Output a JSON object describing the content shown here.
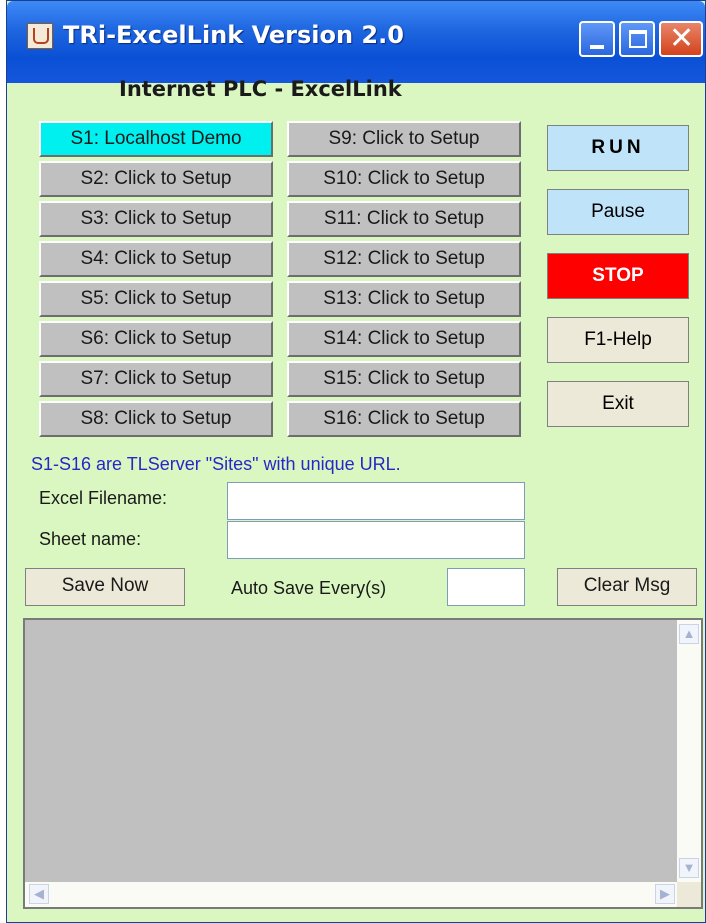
{
  "window": {
    "title": "TRi-ExcelLink Version 2.0",
    "heading": "Internet PLC - ExcelLink"
  },
  "sites": {
    "left": [
      "S1: Localhost Demo",
      "S2: Click to Setup",
      "S3: Click to Setup",
      "S4: Click to Setup",
      "S5: Click to Setup",
      "S6: Click to Setup",
      "S7: Click to Setup",
      "S8: Click to Setup"
    ],
    "right": [
      "S9: Click to Setup",
      "S10: Click to Setup",
      "S11: Click to Setup",
      "S12: Click to Setup",
      "S13: Click to Setup",
      "S14: Click to Setup",
      "S15: Click to Setup",
      "S16: Click to Setup"
    ],
    "selected": "S1: Localhost Demo"
  },
  "controls": {
    "run": "RUN",
    "pause": "Pause",
    "stop": "STOP",
    "help": "F1-Help",
    "exit": "Exit"
  },
  "note": "S1-S16 are TLServer \"Sites\" with unique URL.",
  "form": {
    "excel_filename_label": "Excel Filename:",
    "excel_filename_value": "",
    "sheet_name_label": "Sheet name:",
    "sheet_name_value": "",
    "save_now": "Save Now",
    "auto_save_label": "Auto Save Every(s)",
    "auto_save_value": "",
    "clear_msg": "Clear Msg"
  },
  "messages": "",
  "colors": {
    "background": "#dbf7c1",
    "selected_site": "#00f0f0",
    "stop": "#ff0000",
    "run_pause": "#bfe3f8",
    "note_text": "#2727c8"
  },
  "icons": {
    "app": "java-cup-icon",
    "scroll_up": "chevron-up-icon",
    "scroll_down": "chevron-down-icon",
    "scroll_left": "chevron-left-icon",
    "scroll_right": "chevron-right-icon"
  }
}
